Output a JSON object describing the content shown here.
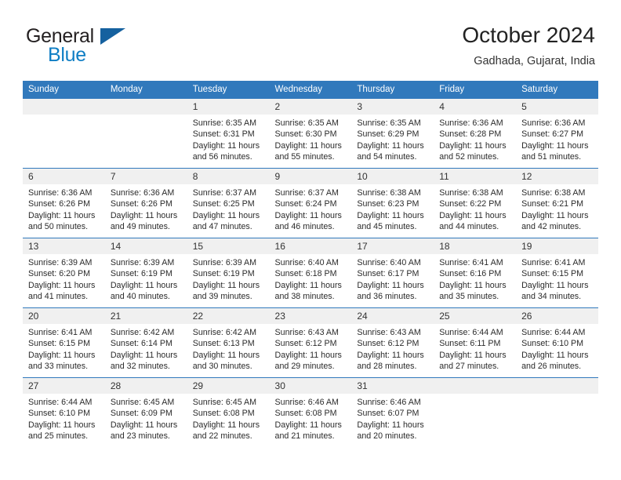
{
  "brand": {
    "name_part1": "General",
    "name_part2": "Blue",
    "flag_color": "#15619f",
    "blue_color": "#0f7ec4"
  },
  "header": {
    "title": "October 2024",
    "location": "Gadhada, Gujarat, India"
  },
  "theme": {
    "header_blue": "#3179bc",
    "daynum_bg": "#f0f0f0"
  },
  "calendar": {
    "weekdays": [
      "Sunday",
      "Monday",
      "Tuesday",
      "Wednesday",
      "Thursday",
      "Friday",
      "Saturday"
    ],
    "weeks": [
      [
        {
          "day": "",
          "sunrise": "",
          "sunset": "",
          "daylight1": "",
          "daylight2": ""
        },
        {
          "day": "",
          "sunrise": "",
          "sunset": "",
          "daylight1": "",
          "daylight2": ""
        },
        {
          "day": "1",
          "sunrise": "Sunrise: 6:35 AM",
          "sunset": "Sunset: 6:31 PM",
          "daylight1": "Daylight: 11 hours",
          "daylight2": "and 56 minutes."
        },
        {
          "day": "2",
          "sunrise": "Sunrise: 6:35 AM",
          "sunset": "Sunset: 6:30 PM",
          "daylight1": "Daylight: 11 hours",
          "daylight2": "and 55 minutes."
        },
        {
          "day": "3",
          "sunrise": "Sunrise: 6:35 AM",
          "sunset": "Sunset: 6:29 PM",
          "daylight1": "Daylight: 11 hours",
          "daylight2": "and 54 minutes."
        },
        {
          "day": "4",
          "sunrise": "Sunrise: 6:36 AM",
          "sunset": "Sunset: 6:28 PM",
          "daylight1": "Daylight: 11 hours",
          "daylight2": "and 52 minutes."
        },
        {
          "day": "5",
          "sunrise": "Sunrise: 6:36 AM",
          "sunset": "Sunset: 6:27 PM",
          "daylight1": "Daylight: 11 hours",
          "daylight2": "and 51 minutes."
        }
      ],
      [
        {
          "day": "6",
          "sunrise": "Sunrise: 6:36 AM",
          "sunset": "Sunset: 6:26 PM",
          "daylight1": "Daylight: 11 hours",
          "daylight2": "and 50 minutes."
        },
        {
          "day": "7",
          "sunrise": "Sunrise: 6:36 AM",
          "sunset": "Sunset: 6:26 PM",
          "daylight1": "Daylight: 11 hours",
          "daylight2": "and 49 minutes."
        },
        {
          "day": "8",
          "sunrise": "Sunrise: 6:37 AM",
          "sunset": "Sunset: 6:25 PM",
          "daylight1": "Daylight: 11 hours",
          "daylight2": "and 47 minutes."
        },
        {
          "day": "9",
          "sunrise": "Sunrise: 6:37 AM",
          "sunset": "Sunset: 6:24 PM",
          "daylight1": "Daylight: 11 hours",
          "daylight2": "and 46 minutes."
        },
        {
          "day": "10",
          "sunrise": "Sunrise: 6:38 AM",
          "sunset": "Sunset: 6:23 PM",
          "daylight1": "Daylight: 11 hours",
          "daylight2": "and 45 minutes."
        },
        {
          "day": "11",
          "sunrise": "Sunrise: 6:38 AM",
          "sunset": "Sunset: 6:22 PM",
          "daylight1": "Daylight: 11 hours",
          "daylight2": "and 44 minutes."
        },
        {
          "day": "12",
          "sunrise": "Sunrise: 6:38 AM",
          "sunset": "Sunset: 6:21 PM",
          "daylight1": "Daylight: 11 hours",
          "daylight2": "and 42 minutes."
        }
      ],
      [
        {
          "day": "13",
          "sunrise": "Sunrise: 6:39 AM",
          "sunset": "Sunset: 6:20 PM",
          "daylight1": "Daylight: 11 hours",
          "daylight2": "and 41 minutes."
        },
        {
          "day": "14",
          "sunrise": "Sunrise: 6:39 AM",
          "sunset": "Sunset: 6:19 PM",
          "daylight1": "Daylight: 11 hours",
          "daylight2": "and 40 minutes."
        },
        {
          "day": "15",
          "sunrise": "Sunrise: 6:39 AM",
          "sunset": "Sunset: 6:19 PM",
          "daylight1": "Daylight: 11 hours",
          "daylight2": "and 39 minutes."
        },
        {
          "day": "16",
          "sunrise": "Sunrise: 6:40 AM",
          "sunset": "Sunset: 6:18 PM",
          "daylight1": "Daylight: 11 hours",
          "daylight2": "and 38 minutes."
        },
        {
          "day": "17",
          "sunrise": "Sunrise: 6:40 AM",
          "sunset": "Sunset: 6:17 PM",
          "daylight1": "Daylight: 11 hours",
          "daylight2": "and 36 minutes."
        },
        {
          "day": "18",
          "sunrise": "Sunrise: 6:41 AM",
          "sunset": "Sunset: 6:16 PM",
          "daylight1": "Daylight: 11 hours",
          "daylight2": "and 35 minutes."
        },
        {
          "day": "19",
          "sunrise": "Sunrise: 6:41 AM",
          "sunset": "Sunset: 6:15 PM",
          "daylight1": "Daylight: 11 hours",
          "daylight2": "and 34 minutes."
        }
      ],
      [
        {
          "day": "20",
          "sunrise": "Sunrise: 6:41 AM",
          "sunset": "Sunset: 6:15 PM",
          "daylight1": "Daylight: 11 hours",
          "daylight2": "and 33 minutes."
        },
        {
          "day": "21",
          "sunrise": "Sunrise: 6:42 AM",
          "sunset": "Sunset: 6:14 PM",
          "daylight1": "Daylight: 11 hours",
          "daylight2": "and 32 minutes."
        },
        {
          "day": "22",
          "sunrise": "Sunrise: 6:42 AM",
          "sunset": "Sunset: 6:13 PM",
          "daylight1": "Daylight: 11 hours",
          "daylight2": "and 30 minutes."
        },
        {
          "day": "23",
          "sunrise": "Sunrise: 6:43 AM",
          "sunset": "Sunset: 6:12 PM",
          "daylight1": "Daylight: 11 hours",
          "daylight2": "and 29 minutes."
        },
        {
          "day": "24",
          "sunrise": "Sunrise: 6:43 AM",
          "sunset": "Sunset: 6:12 PM",
          "daylight1": "Daylight: 11 hours",
          "daylight2": "and 28 minutes."
        },
        {
          "day": "25",
          "sunrise": "Sunrise: 6:44 AM",
          "sunset": "Sunset: 6:11 PM",
          "daylight1": "Daylight: 11 hours",
          "daylight2": "and 27 minutes."
        },
        {
          "day": "26",
          "sunrise": "Sunrise: 6:44 AM",
          "sunset": "Sunset: 6:10 PM",
          "daylight1": "Daylight: 11 hours",
          "daylight2": "and 26 minutes."
        }
      ],
      [
        {
          "day": "27",
          "sunrise": "Sunrise: 6:44 AM",
          "sunset": "Sunset: 6:10 PM",
          "daylight1": "Daylight: 11 hours",
          "daylight2": "and 25 minutes."
        },
        {
          "day": "28",
          "sunrise": "Sunrise: 6:45 AM",
          "sunset": "Sunset: 6:09 PM",
          "daylight1": "Daylight: 11 hours",
          "daylight2": "and 23 minutes."
        },
        {
          "day": "29",
          "sunrise": "Sunrise: 6:45 AM",
          "sunset": "Sunset: 6:08 PM",
          "daylight1": "Daylight: 11 hours",
          "daylight2": "and 22 minutes."
        },
        {
          "day": "30",
          "sunrise": "Sunrise: 6:46 AM",
          "sunset": "Sunset: 6:08 PM",
          "daylight1": "Daylight: 11 hours",
          "daylight2": "and 21 minutes."
        },
        {
          "day": "31",
          "sunrise": "Sunrise: 6:46 AM",
          "sunset": "Sunset: 6:07 PM",
          "daylight1": "Daylight: 11 hours",
          "daylight2": "and 20 minutes."
        },
        {
          "day": "",
          "sunrise": "",
          "sunset": "",
          "daylight1": "",
          "daylight2": ""
        },
        {
          "day": "",
          "sunrise": "",
          "sunset": "",
          "daylight1": "",
          "daylight2": ""
        }
      ]
    ]
  }
}
